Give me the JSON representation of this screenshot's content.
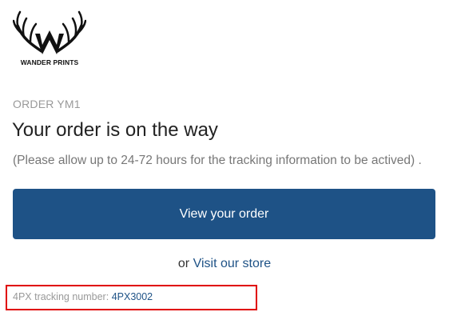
{
  "brand": {
    "name": "WANDER PRINTS",
    "logo_icon": "antlers-w-logo-icon"
  },
  "order": {
    "label": "ORDER YM1"
  },
  "main": {
    "title": "Your order is on the way",
    "subtitle": "(Please allow up to 24-72 hours for the tracking information to be actived) ."
  },
  "actions": {
    "view_order_label": "View your order",
    "or_text": "or",
    "visit_store_label": "Visit our store"
  },
  "tracking": {
    "label": "4PX tracking number:",
    "number": "4PX3002"
  },
  "colors": {
    "button": "#1e5286",
    "link": "#1e5286",
    "highlight_border": "#e00000",
    "muted_text": "#999999"
  }
}
